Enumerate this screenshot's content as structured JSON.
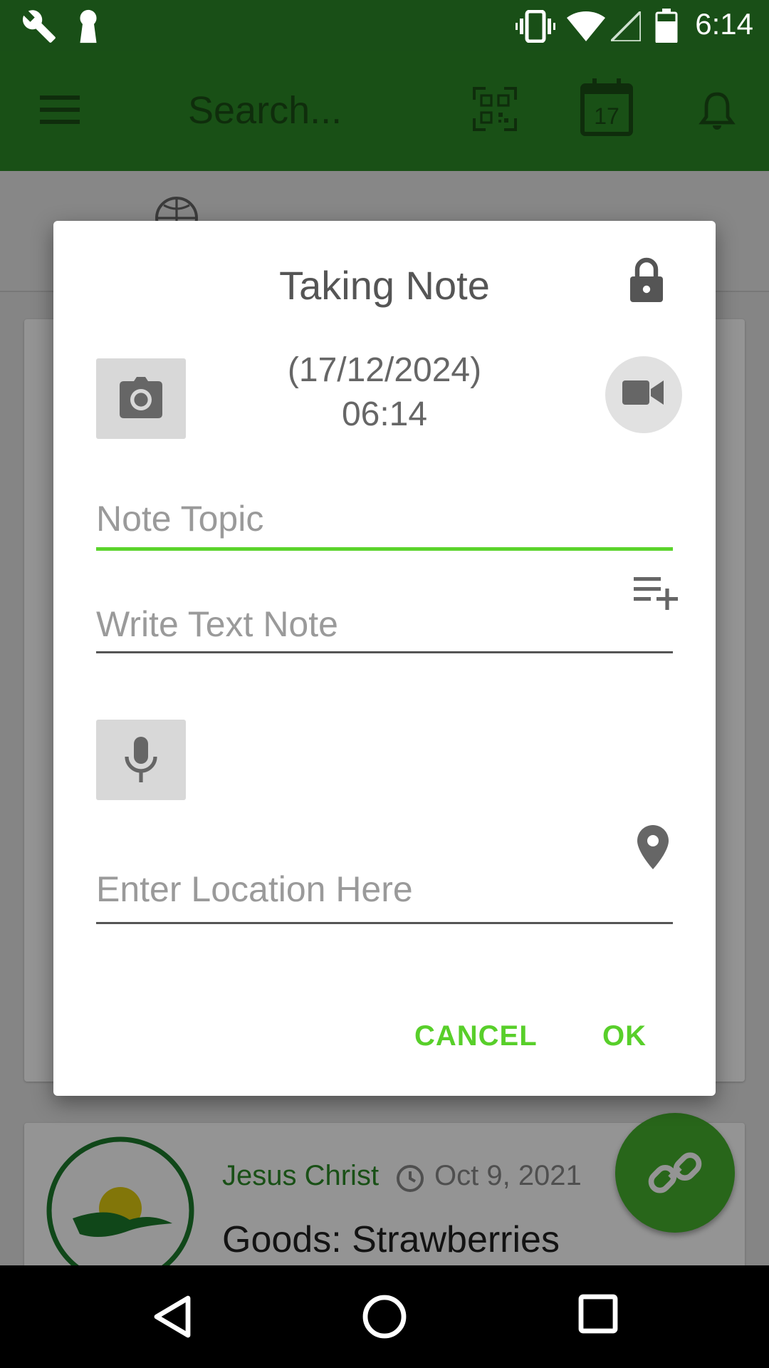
{
  "status_bar": {
    "time": "6:14",
    "icons": [
      "wrench-icon",
      "keyhole-icon",
      "vibrate-icon",
      "wifi-icon",
      "signal-icon",
      "battery-icon"
    ]
  },
  "toolbar": {
    "search_placeholder": "Search...",
    "calendar_day": "17",
    "icons": [
      "menu-icon",
      "qr-code-icon",
      "calendar-icon",
      "bell-icon"
    ]
  },
  "background": {
    "post": {
      "author": "Jesus Christ",
      "date": "Oct 9, 2021",
      "title": "Goods: Strawberries"
    }
  },
  "dialog": {
    "title": "Taking Note",
    "date": "(17/12/2024)",
    "time": "06:14",
    "note_topic_placeholder": "Note Topic",
    "note_topic_value": "",
    "text_note_placeholder": "Write Text Note",
    "text_note_value": "",
    "location_placeholder": "Enter Location Here",
    "location_value": "",
    "cancel_label": "CANCEL",
    "ok_label": "OK"
  },
  "colors": {
    "toolbar": "#2b8a26",
    "status_bar": "#194f17",
    "accent": "#58cf2a",
    "field_focus": "#5bd42c"
  }
}
